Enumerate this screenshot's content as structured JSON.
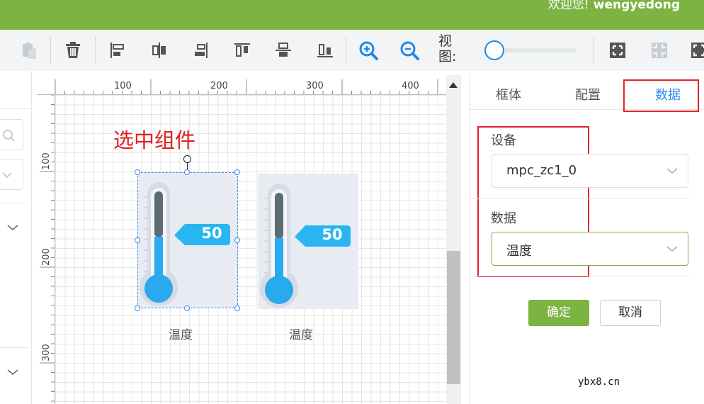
{
  "header": {
    "greeting": "欢迎您!",
    "username": "wengyedong",
    "color": "#7cb342"
  },
  "toolbar": {
    "buttons": [
      {
        "name": "paste-icon"
      },
      {
        "name": "delete-icon"
      },
      {
        "name": "align-left-icon"
      },
      {
        "name": "align-center-horizontal-icon"
      },
      {
        "name": "align-right-icon"
      },
      {
        "name": "align-top-icon"
      },
      {
        "name": "align-middle-vertical-icon"
      },
      {
        "name": "align-bottom-icon"
      },
      {
        "name": "zoom-in-icon"
      },
      {
        "name": "zoom-out-icon"
      }
    ],
    "view_label": "视图:",
    "view_zoom": 0.1,
    "right_buttons": [
      {
        "name": "fit-screen-icon"
      },
      {
        "name": "actual-size-icon"
      },
      {
        "name": "fullscreen-icon"
      }
    ]
  },
  "ruler": {
    "top_labels": [
      "100",
      "200",
      "300",
      "400"
    ],
    "left_labels": [
      "100",
      "200",
      "300"
    ]
  },
  "canvas": {
    "annotation": "选中组件",
    "components": [
      {
        "value": "50",
        "caption": "温度",
        "selected": true
      },
      {
        "value": "50",
        "caption": "温度",
        "selected": false
      }
    ]
  },
  "panel": {
    "tabs": [
      "框体",
      "配置",
      "数据"
    ],
    "active_tab": "数据",
    "device_label": "设备",
    "device_value": "mpc_zc1_0",
    "data_label": "数据",
    "data_value": "温度",
    "ok_label": "确定",
    "cancel_label": "取消"
  },
  "watermark": "ybx8.cn",
  "colors": {
    "accent": "#2d8cf0",
    "primary_green": "#7cb342",
    "annotation_red": "#e0252b",
    "thermo_blue": "#29a9ee"
  }
}
